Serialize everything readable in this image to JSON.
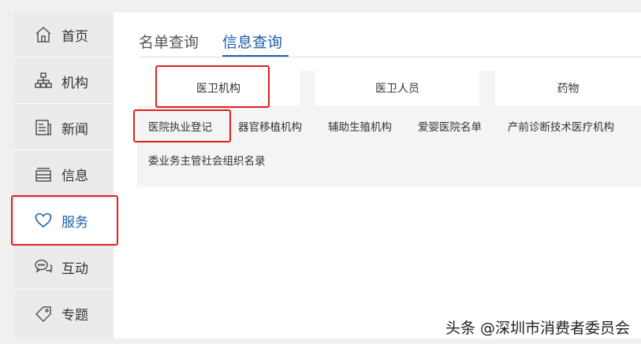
{
  "sidebar": {
    "items": [
      {
        "label": "首页",
        "icon": "home-icon"
      },
      {
        "label": "机构",
        "icon": "org-chart-icon"
      },
      {
        "label": "新闻",
        "icon": "news-icon"
      },
      {
        "label": "信息",
        "icon": "info-stack-icon"
      },
      {
        "label": "服务",
        "icon": "heart-icon"
      },
      {
        "label": "互动",
        "icon": "chat-bubbles-icon"
      },
      {
        "label": "专题",
        "icon": "tag-icon"
      }
    ],
    "active_index": 4
  },
  "tabs": [
    {
      "label": "名单查询"
    },
    {
      "label": "信息查询"
    }
  ],
  "categories": [
    {
      "label": "医卫机构"
    },
    {
      "label": "医卫人员"
    },
    {
      "label": "药物"
    }
  ],
  "sublinks": [
    {
      "label": "医院执业登记"
    },
    {
      "label": "器官移植机构"
    },
    {
      "label": "辅助生殖机构"
    },
    {
      "label": "爱婴医院名单"
    },
    {
      "label": "产前诊断技术医疗机构"
    },
    {
      "label": "委业务主管社会组织名录"
    }
  ],
  "watermark": "头条 @深圳市消费者委员会",
  "colors": {
    "accent": "#1f5fa8",
    "highlight_box": "#e02020",
    "sidebar_bg": "#ebebeb",
    "panel_bg": "#f4f4f4"
  }
}
